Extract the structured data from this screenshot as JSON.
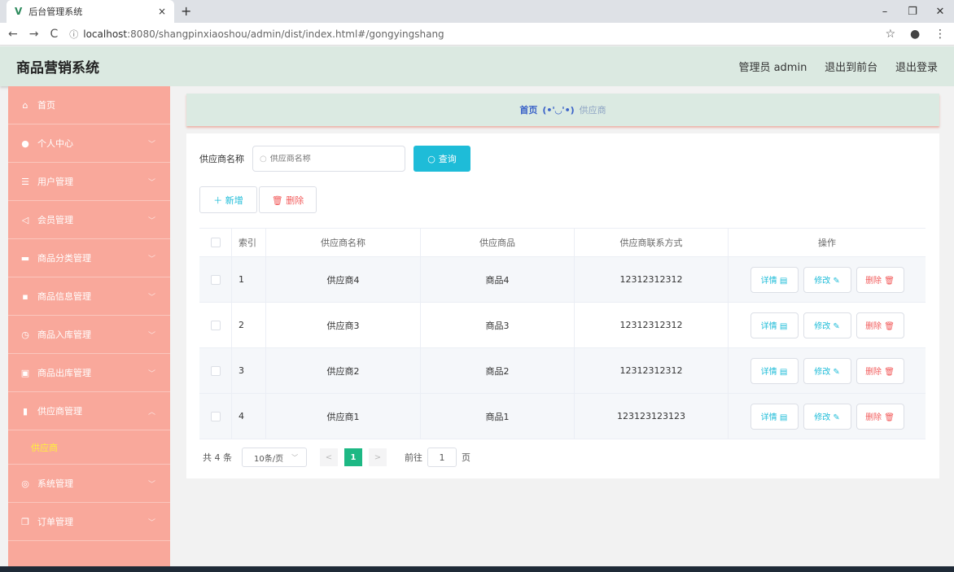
{
  "browser": {
    "tab_title": "后台管理系统",
    "tab_logo": "V",
    "close_tab": "×",
    "new_tab": "+",
    "url_host": "localhost",
    "url_rest": ":8080/shangpinxiaoshou/admin/dist/index.html#/gongyingshang",
    "back": "←",
    "forward": "→",
    "reload": "C",
    "info": "ⓘ",
    "star": "☆",
    "account": "●",
    "menu": "⋮",
    "minimize": "–",
    "maximize": "❐",
    "close": "✕"
  },
  "header": {
    "brand": "商品营销系统",
    "user": "管理员 admin",
    "to_front": "退出到前台",
    "logout": "退出登录"
  },
  "sidebar": {
    "items": [
      {
        "icon": "home-icon",
        "glyph": "⌂",
        "label": "首页",
        "arrow": ""
      },
      {
        "icon": "user-icon",
        "glyph": "●",
        "label": "个人中心",
        "arrow": "﹀"
      },
      {
        "icon": "list-icon",
        "glyph": "☰",
        "label": "用户管理",
        "arrow": "﹀"
      },
      {
        "icon": "send-icon",
        "glyph": "◁",
        "label": "会员管理",
        "arrow": "﹀"
      },
      {
        "icon": "monitor-icon",
        "glyph": "▬",
        "label": "商品分类管理",
        "arrow": "﹀"
      },
      {
        "icon": "chat-icon",
        "glyph": "▪",
        "label": "商品信息管理",
        "arrow": "﹀"
      },
      {
        "icon": "clock-icon",
        "glyph": "◷",
        "label": "商品入库管理",
        "arrow": "﹀"
      },
      {
        "icon": "box-icon",
        "glyph": "▣",
        "label": "商品出库管理",
        "arrow": "﹀"
      },
      {
        "icon": "chart-icon",
        "glyph": "▮",
        "label": "供应商管理",
        "arrow": "︿"
      },
      {
        "icon": "globe-icon",
        "glyph": "◎",
        "label": "系统管理",
        "arrow": "﹀"
      },
      {
        "icon": "copy-icon",
        "glyph": "❐",
        "label": "订单管理",
        "arrow": "﹀"
      }
    ],
    "active_sub": "供应商"
  },
  "breadcrumb": {
    "home": "首页",
    "sep": "(•'◡'•)",
    "current": "供应商"
  },
  "search": {
    "label": "供应商名称",
    "placeholder": "供应商名称",
    "button": "查询",
    "search_glyph": "○"
  },
  "actions": {
    "add": "＋ 新增",
    "delete": "🗑 删除"
  },
  "table": {
    "headers": [
      "索引",
      "供应商名称",
      "供应商品",
      "供应商联系方式",
      "操作"
    ],
    "rows": [
      {
        "index": "1",
        "name": "供应商4",
        "goods": "商品4",
        "contact": "12312312312"
      },
      {
        "index": "2",
        "name": "供应商3",
        "goods": "商品3",
        "contact": "12312312312"
      },
      {
        "index": "3",
        "name": "供应商2",
        "goods": "商品2",
        "contact": "12312312312"
      },
      {
        "index": "4",
        "name": "供应商1",
        "goods": "商品1",
        "contact": "123123123123"
      }
    ],
    "op_detail": "详情 ▤",
    "op_edit": "修改 ✎",
    "op_delete": "删除 🗑"
  },
  "pagination": {
    "total": "共 4 条",
    "page_size": "10条/页",
    "prev": "<",
    "current": "1",
    "next": ">",
    "goto_pre": "前往",
    "goto_value": "1",
    "goto_post": "页"
  },
  "colors": {
    "accent": "#1ebcd8",
    "danger": "#f25b5b",
    "sidebar": "#f9a89b",
    "header": "#dbe9e1",
    "pager_active": "#1db884"
  }
}
